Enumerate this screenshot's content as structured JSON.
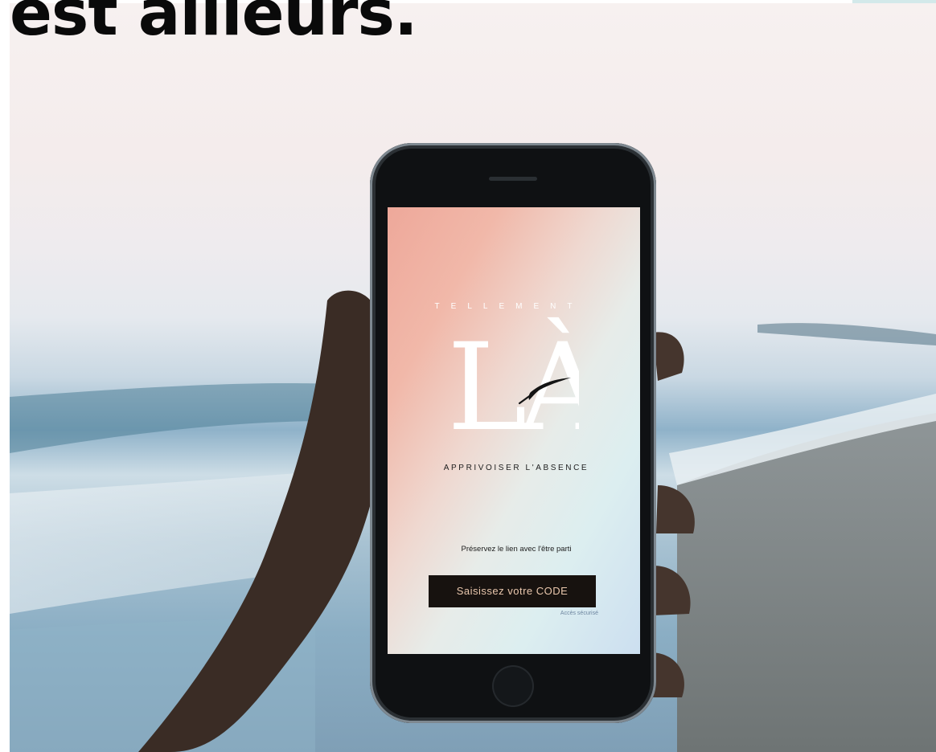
{
  "headline": "est ailleurs.",
  "app": {
    "brand_top": "TELLEMENT",
    "brand_mark": "LÀ",
    "tagline": "APPRIVOISER L'ABSENCE",
    "subline": "Préservez le lien avec l'être parti",
    "cta_label": "Saisissez votre CODE",
    "secure_note": "Accès sécurisé"
  },
  "colors": {
    "headline_text": "#0a0a0a",
    "button_bg": "#17120f",
    "button_text": "#e9c7ad",
    "screen_gradient_start": "#eea89a",
    "screen_gradient_end": "#ccdff0"
  },
  "icons": [
    "bird-icon",
    "home-button-icon"
  ]
}
